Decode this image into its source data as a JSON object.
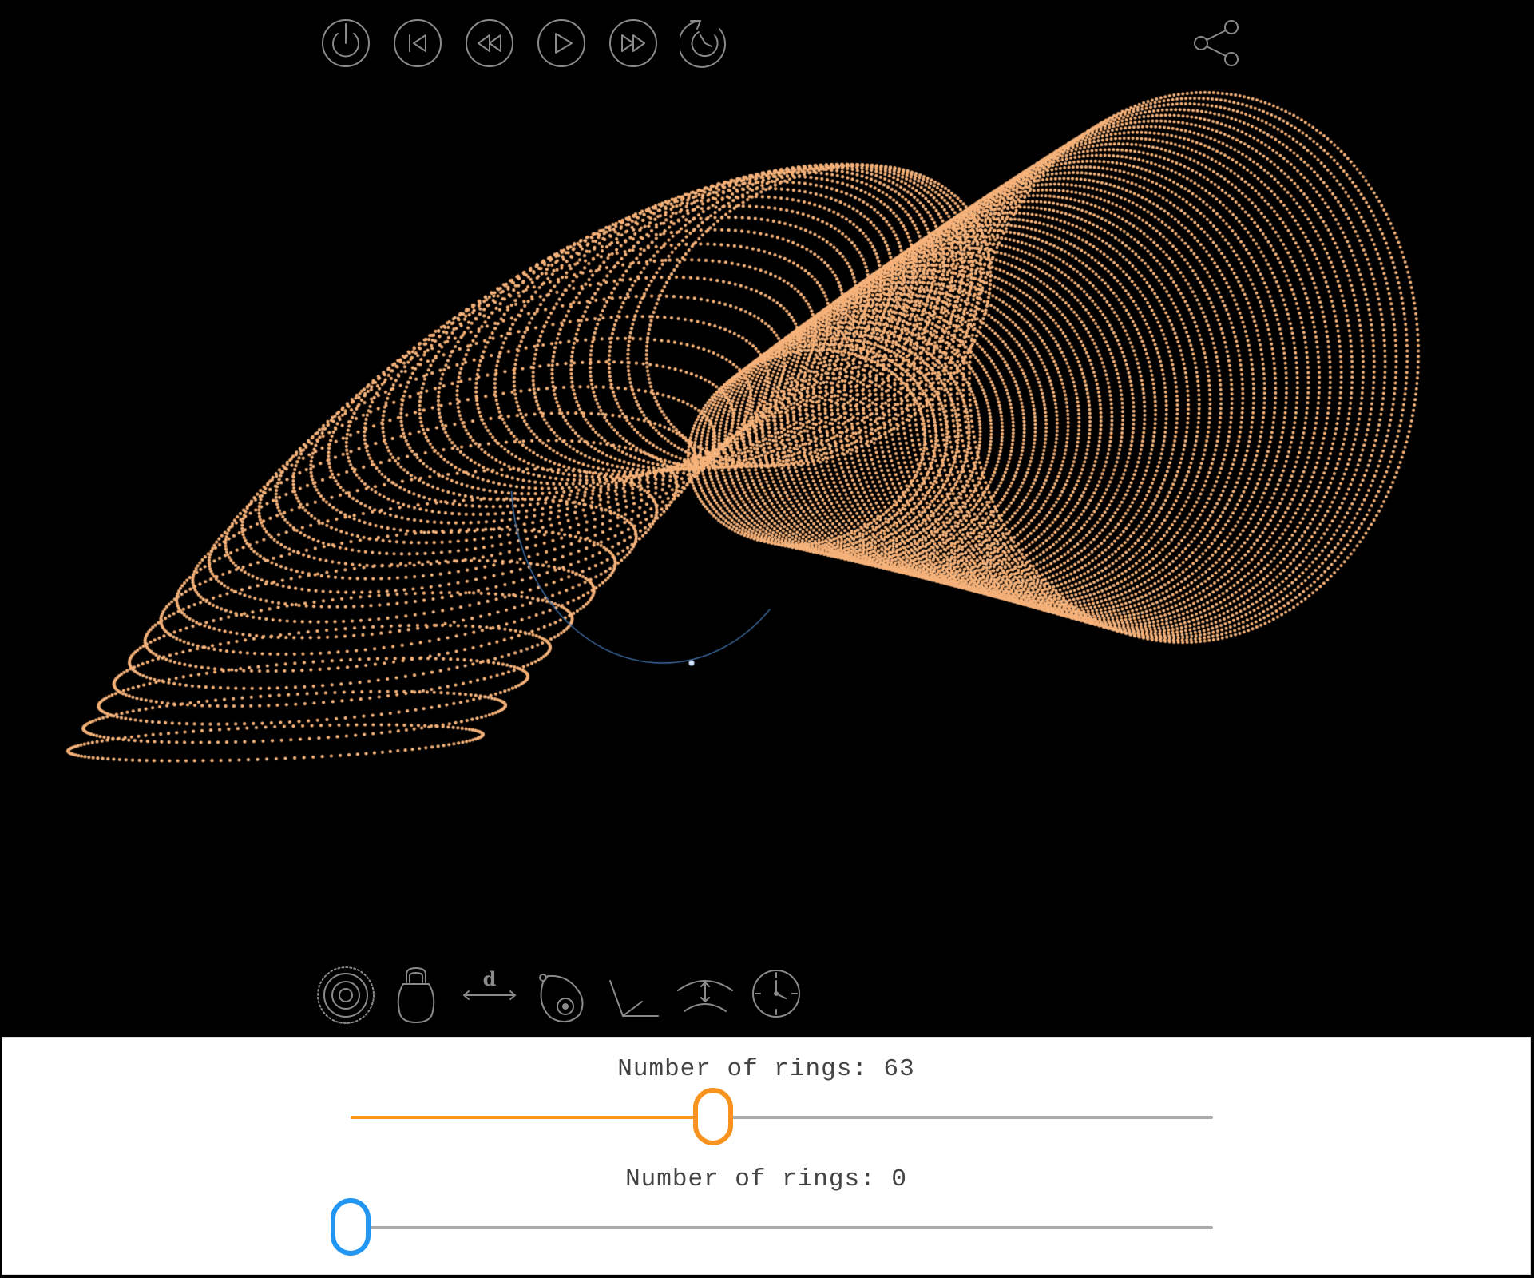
{
  "toolbar_top": {
    "icons": [
      "power-icon",
      "skip-back-icon",
      "rewind-icon",
      "play-icon",
      "fast-forward-icon",
      "reset-icon"
    ],
    "share_icon": "share-icon"
  },
  "toolbar_bottom": {
    "icons": [
      "rings-icon",
      "weight-icon",
      "distance-icon",
      "orbit-icon",
      "angle-icon",
      "arc-icon",
      "clock-icon"
    ],
    "distance_symbol": "d"
  },
  "visualization": {
    "dot_color": "#f5b27a",
    "helper_arc_color": "#3f6fa8"
  },
  "sliders": [
    {
      "label": "Number of rings: 63",
      "value_fraction": 0.42,
      "accent": "#f7931e"
    },
    {
      "label": "Number of rings: 0",
      "value_fraction": 0.0,
      "accent": "#2196f3"
    }
  ]
}
